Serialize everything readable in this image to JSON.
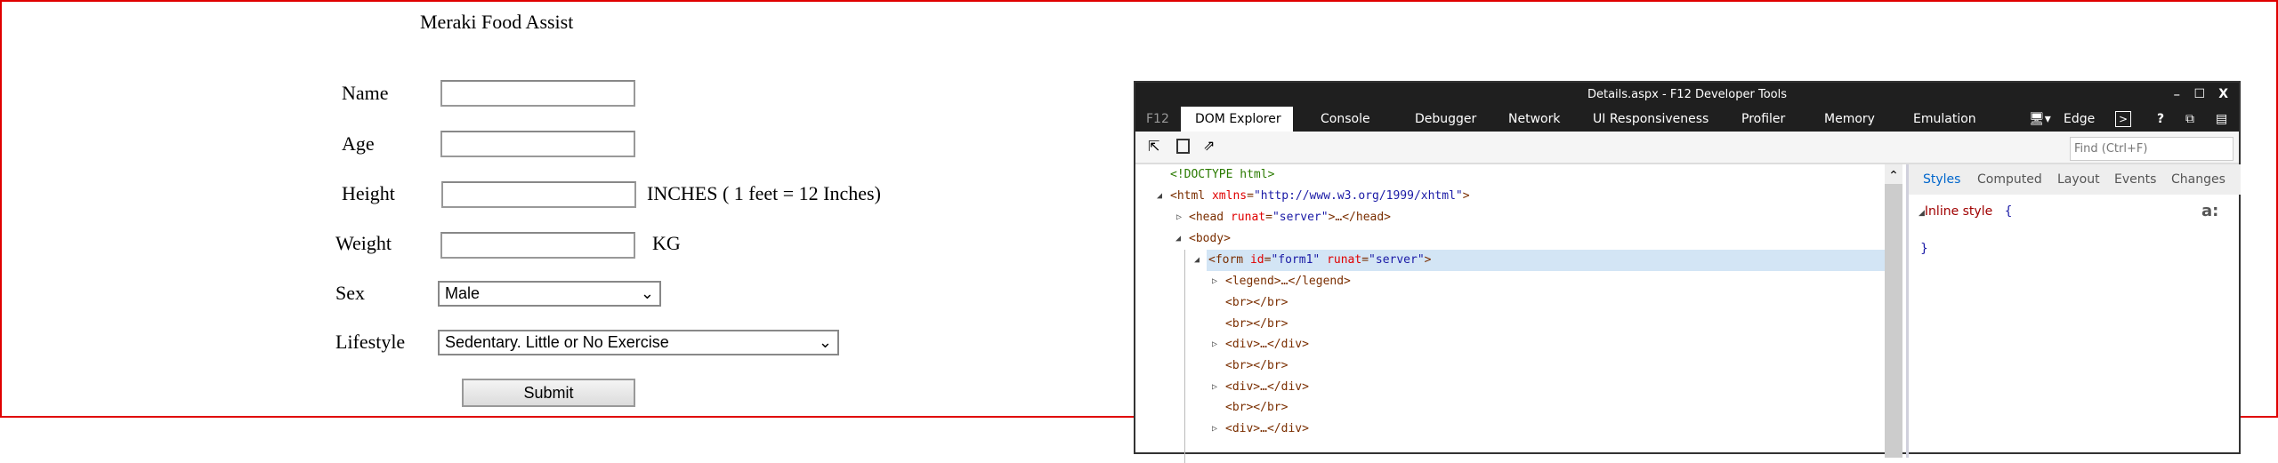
{
  "page": {
    "title": "Meraki Food Assist",
    "fields": [
      {
        "label": "Name",
        "value": ""
      },
      {
        "label": "Age",
        "value": ""
      },
      {
        "label": "Height",
        "value": "",
        "suffix": "INCHES ( 1 feet = 12 Inches)"
      },
      {
        "label": "Weight",
        "value": "",
        "suffix": "KG"
      }
    ],
    "sex": {
      "label": "Sex",
      "value": "Male"
    },
    "lifestyle": {
      "label": "Lifestyle",
      "value": "Sedentary. Little or No Exercise"
    },
    "submit": "Submit"
  },
  "devtools": {
    "title": "Details.aspx - F12 Developer Tools",
    "f12": "F12",
    "tabs": [
      "DOM Explorer",
      "Console",
      "Debugger",
      "Network",
      "UI Responsiveness",
      "Profiler",
      "Memory",
      "Emulation"
    ],
    "mode": "Edge",
    "find_placeholder": "Find (Ctrl+F)",
    "dom": {
      "doctype": "<!DOCTYPE html>",
      "html_open": "<html",
      "xmlns_attr": "xmlns",
      "xmlns_val": "\"http://www.w3.org/1999/xhtml\"",
      "head_open": "<head",
      "runat": "runat",
      "server": "\"server\"",
      "head_close": ">…</head>",
      "body": "<body>",
      "form_open": "<form",
      "id_attr": "id",
      "id_val": "\"form1\"",
      "legend": "<legend>…</legend>",
      "br": "<br></br>",
      "div": "<div>…</div>",
      "eq": "=",
      "gt": ">"
    },
    "styles_tabs": [
      "Styles",
      "Computed",
      "Layout",
      "Events",
      "Changes"
    ],
    "inline_style": "Inline style",
    "open_brace": "{",
    "close_brace": "}",
    "pseudo": "a:"
  },
  "colors": {
    "accent": "#0066cc",
    "highlight": "#d3e5f5",
    "frame": "#e00000"
  }
}
